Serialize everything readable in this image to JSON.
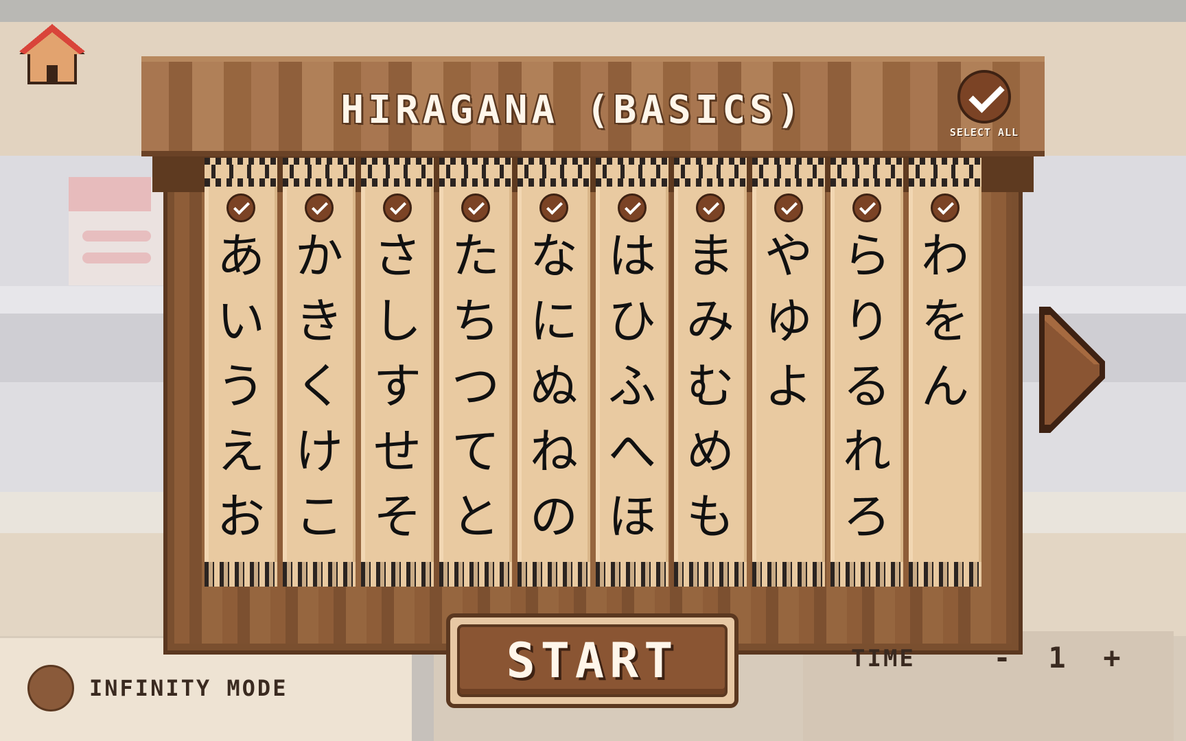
{
  "header": {
    "title": "HIRAGANA (BASICS)",
    "select_all_label": "SELECT ALL",
    "select_all_checked": true
  },
  "columns": [
    {
      "checked": true,
      "chars": [
        "あ",
        "い",
        "う",
        "え",
        "お"
      ]
    },
    {
      "checked": true,
      "chars": [
        "か",
        "き",
        "く",
        "け",
        "こ"
      ]
    },
    {
      "checked": true,
      "chars": [
        "さ",
        "し",
        "す",
        "せ",
        "そ"
      ]
    },
    {
      "checked": true,
      "chars": [
        "た",
        "ち",
        "つ",
        "て",
        "と"
      ]
    },
    {
      "checked": true,
      "chars": [
        "な",
        "に",
        "ぬ",
        "ね",
        "の"
      ]
    },
    {
      "checked": true,
      "chars": [
        "は",
        "ひ",
        "ふ",
        "へ",
        "ほ"
      ]
    },
    {
      "checked": true,
      "chars": [
        "ま",
        "み",
        "む",
        "め",
        "も"
      ]
    },
    {
      "checked": true,
      "chars": [
        "や",
        "ゆ",
        "よ"
      ]
    },
    {
      "checked": true,
      "chars": [
        "ら",
        "り",
        "る",
        "れ",
        "ろ"
      ]
    },
    {
      "checked": true,
      "chars": [
        "わ",
        "を",
        "ん"
      ]
    }
  ],
  "controls": {
    "start_label": "START",
    "infinity_mode_label": "INFINITY MODE",
    "infinity_mode_on": false,
    "time_label": "TIME",
    "time_minus": "-",
    "time_value": "1",
    "time_plus": "+"
  },
  "icons": {
    "home": "home-icon",
    "next": "arrow-right-icon",
    "check": "check-icon"
  },
  "colors": {
    "wood_dark": "#5b3820",
    "wood_mid": "#8a5533",
    "paper": "#e9caa1",
    "check_fill": "#7b4325",
    "text_light": "#fff6ea"
  }
}
